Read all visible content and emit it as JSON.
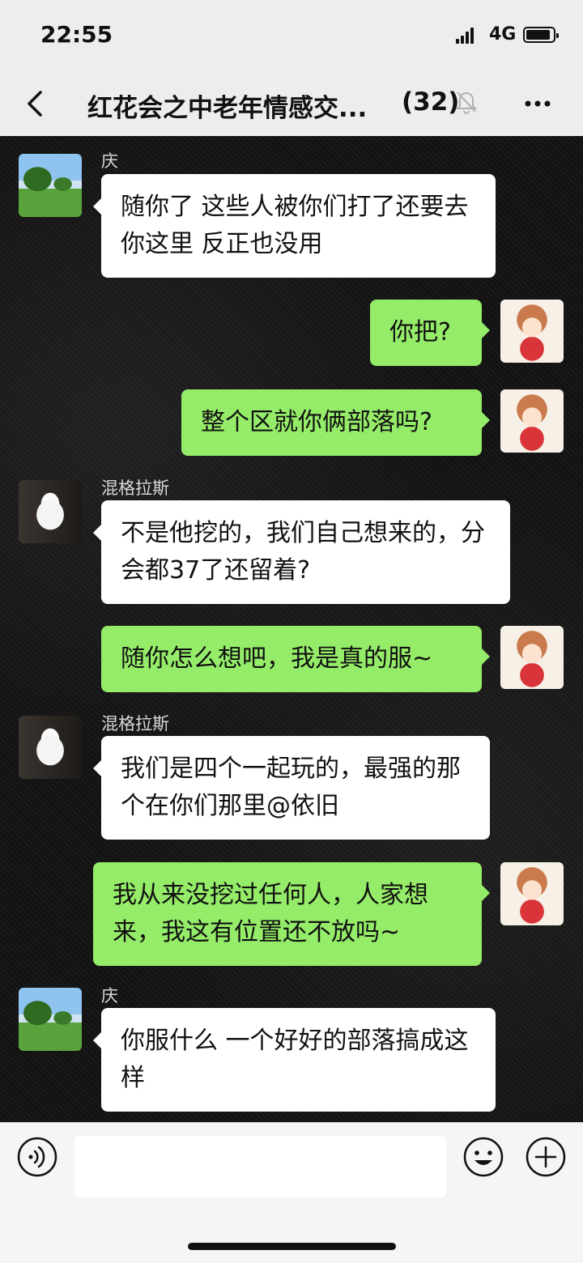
{
  "status": {
    "time": "22:55",
    "network": "4G"
  },
  "header": {
    "title": "红花会之中老年情感交...",
    "member_count": "(32)"
  },
  "messages": [
    {
      "side": "left",
      "sender": "庆",
      "text": "随你了 这些人被你们打了还要去你这里 反正也没用"
    },
    {
      "side": "right",
      "text": "你把?"
    },
    {
      "side": "right",
      "text": "整个区就你俩部落吗?"
    },
    {
      "side": "left",
      "sender": "混格拉斯",
      "text": "不是他挖的，我们自己想来的，分会都37了还留着?"
    },
    {
      "side": "right",
      "text": "随你怎么想吧，我是真的服~"
    },
    {
      "side": "left",
      "sender": "混格拉斯",
      "text": "我们是四个一起玩的，最强的那个在你们那里@依旧"
    },
    {
      "side": "right",
      "text": "我从来没挖过任何人，人家想来，我这有位置还不放吗~"
    },
    {
      "side": "left",
      "sender": "庆",
      "text": "你服什么 一个好好的部落搞成这样"
    }
  ],
  "colors": {
    "bubble_self": "#95ec69",
    "bubble_other": "#ffffff",
    "bar_bg": "#ededed"
  }
}
